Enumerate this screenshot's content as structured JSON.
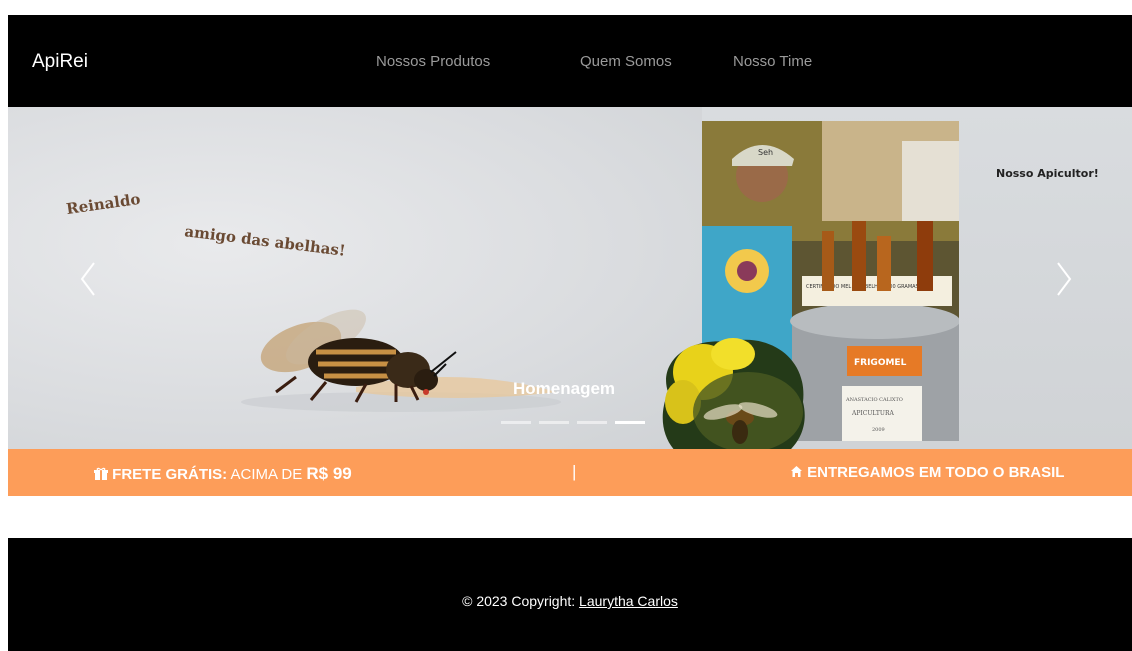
{
  "navbar": {
    "brand": "ApiRei",
    "links": [
      "Nossos Produtos",
      "Quem Somos",
      "Nosso Time"
    ]
  },
  "carousel": {
    "overlay_text": {
      "name": "Reinaldo",
      "tagline": "amigo das abelhas!",
      "apicultor": "Nosso Apicultor!"
    },
    "caption": "Homenagem",
    "indicators": 4,
    "active_indicator": 4,
    "photo_labels": {
      "cap": "Seh",
      "drum_brand": "FRIGOMEL",
      "note_name": "ANASTACIO CALIXTO",
      "note_role": "APICULTURA",
      "note_year": "2009",
      "shelf_sign": "CERTIFICADO MEL DE ABELHA 1000 GRAMAS"
    }
  },
  "promo": {
    "left_strong": "FRETE GRÁTIS:",
    "left_text": " ACIMA DE ",
    "left_amount": "R$ 99",
    "separator": "|",
    "right": "ENTREGAMOS EM TODO O BRASIL"
  },
  "footer": {
    "copyright": "© 2023 Copyright: ",
    "author": "Laurytha Carlos"
  },
  "colors": {
    "navbar_bg": "#000000",
    "promo_bg": "#fd9d59",
    "footer_bg": "#000000",
    "nav_link": "#9a9a9a"
  }
}
